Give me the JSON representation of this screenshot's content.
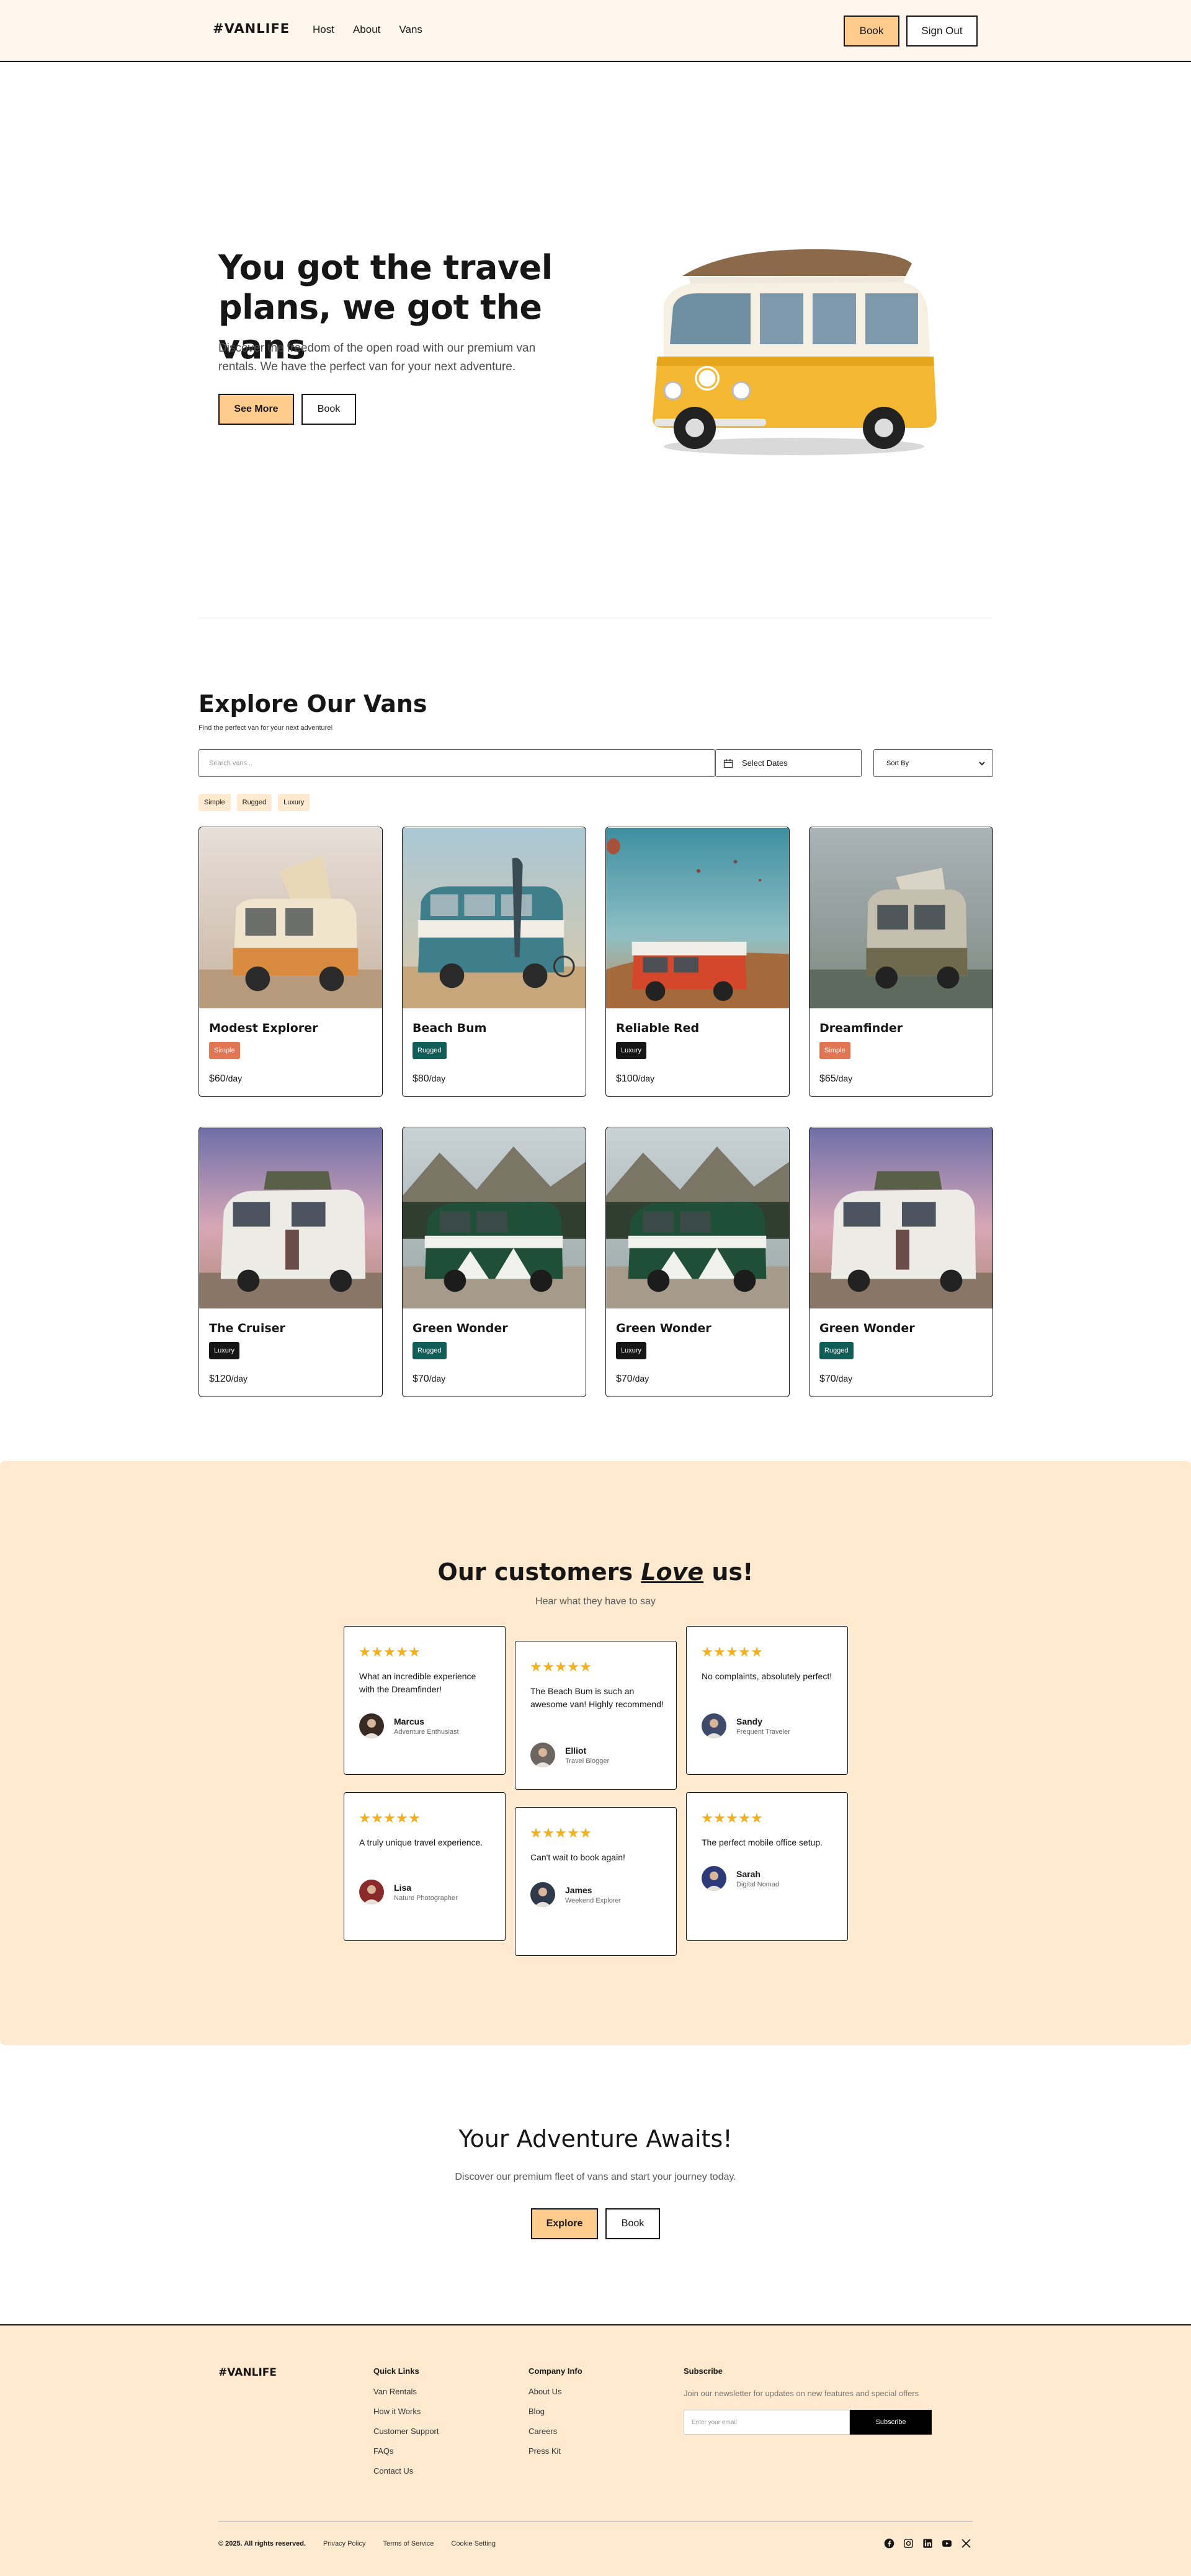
{
  "nav": {
    "logo": "#VANLIFE",
    "links": [
      "Host",
      "About",
      "Vans"
    ],
    "book_label": "Book",
    "signout_label": "Sign Out"
  },
  "hero": {
    "title": "You got the travel plans, we got the vans",
    "subtitle": "Discover the freedom of the open road with our premium van rentals. We have the perfect van for your next adventure.",
    "primary_label": "See More",
    "secondary_label": "Book"
  },
  "explore": {
    "title": "Explore Our Vans",
    "subtitle": "Find the perfect van for your next adventure!",
    "search_placeholder": "Search vans...",
    "dates_label": "Select Dates",
    "sort_label": "Sort By",
    "filters": [
      "Simple",
      "Rugged",
      "Luxury"
    ],
    "vans": [
      {
        "name": "Modest Explorer",
        "type": "Simple",
        "price": "$60",
        "per": "/day"
      },
      {
        "name": "Beach Bum",
        "type": "Rugged",
        "price": "$80",
        "per": "/day"
      },
      {
        "name": "Reliable Red",
        "type": "Luxury",
        "price": "$100",
        "per": "/day"
      },
      {
        "name": "Dreamfinder",
        "type": "Simple",
        "price": "$65",
        "per": "/day"
      },
      {
        "name": "The Cruiser",
        "type": "Luxury",
        "price": "$120",
        "per": "/day"
      },
      {
        "name": "Green Wonder",
        "type": "Rugged",
        "price": "$70",
        "per": "/day"
      },
      {
        "name": "Green Wonder",
        "type": "Luxury",
        "price": "$70",
        "per": "/day"
      },
      {
        "name": "Green Wonder",
        "type": "Rugged",
        "price": "$70",
        "per": "/day"
      }
    ]
  },
  "testimonials": {
    "title_prefix": "Our customers",
    "title_em": "Love",
    "title_suffix": "us!",
    "subtitle": "Hear what they have to say",
    "rating": 5,
    "items": [
      {
        "quote": "What an incredible experience with the Dreamfinder!",
        "name": "Marcus",
        "role": "Adventure Enthusiast"
      },
      {
        "quote": "The Beach Bum is such an awesome van! Highly recommend!",
        "name": "Elliot",
        "role": "Travel Blogger"
      },
      {
        "quote": "No complaints, absolutely perfect!",
        "name": "Sandy",
        "role": "Frequent Traveler"
      },
      {
        "quote": "A truly unique travel experience.",
        "name": "Lisa",
        "role": "Nature Photographer"
      },
      {
        "quote": "Can't wait to book again!",
        "name": "James",
        "role": "Weekend Explorer"
      },
      {
        "quote": "The perfect mobile office setup.",
        "name": "Sarah",
        "role": "Digital Nomad"
      }
    ]
  },
  "cta": {
    "title": "Your Adventure Awaits!",
    "subtitle": "Discover our premium fleet of vans and start your journey today.",
    "primary_label": "Explore",
    "secondary_label": "Book"
  },
  "footer": {
    "logo": "#VANLIFE",
    "quick_links_title": "Quick Links",
    "quick_links": [
      "Van Rentals",
      "How it Works",
      "Customer Support",
      "FAQs",
      "Contact Us"
    ],
    "company_title": "Company Info",
    "company_links": [
      "About Us",
      "Blog",
      "Careers",
      "Press Kit"
    ],
    "subscribe_title": "Subscribe",
    "subscribe_text": "Join our newsletter for updates on new features and special offers",
    "email_placeholder": "Enter your email",
    "subscribe_label": "Subscribe",
    "copyright": "© 2025. All rights reserved.",
    "legal": [
      "Privacy Policy",
      "Terms of Service",
      "Cookie Setting"
    ],
    "socials": [
      "facebook-icon",
      "instagram-icon",
      "linkedin-icon",
      "youtube-icon",
      "x-icon"
    ]
  },
  "colors": {
    "peach": "#ffcc8d",
    "cream": "#ffead0",
    "simple": "#e17654",
    "rugged": "#115e59",
    "luxury": "#161616",
    "star": "#f2b01e"
  }
}
